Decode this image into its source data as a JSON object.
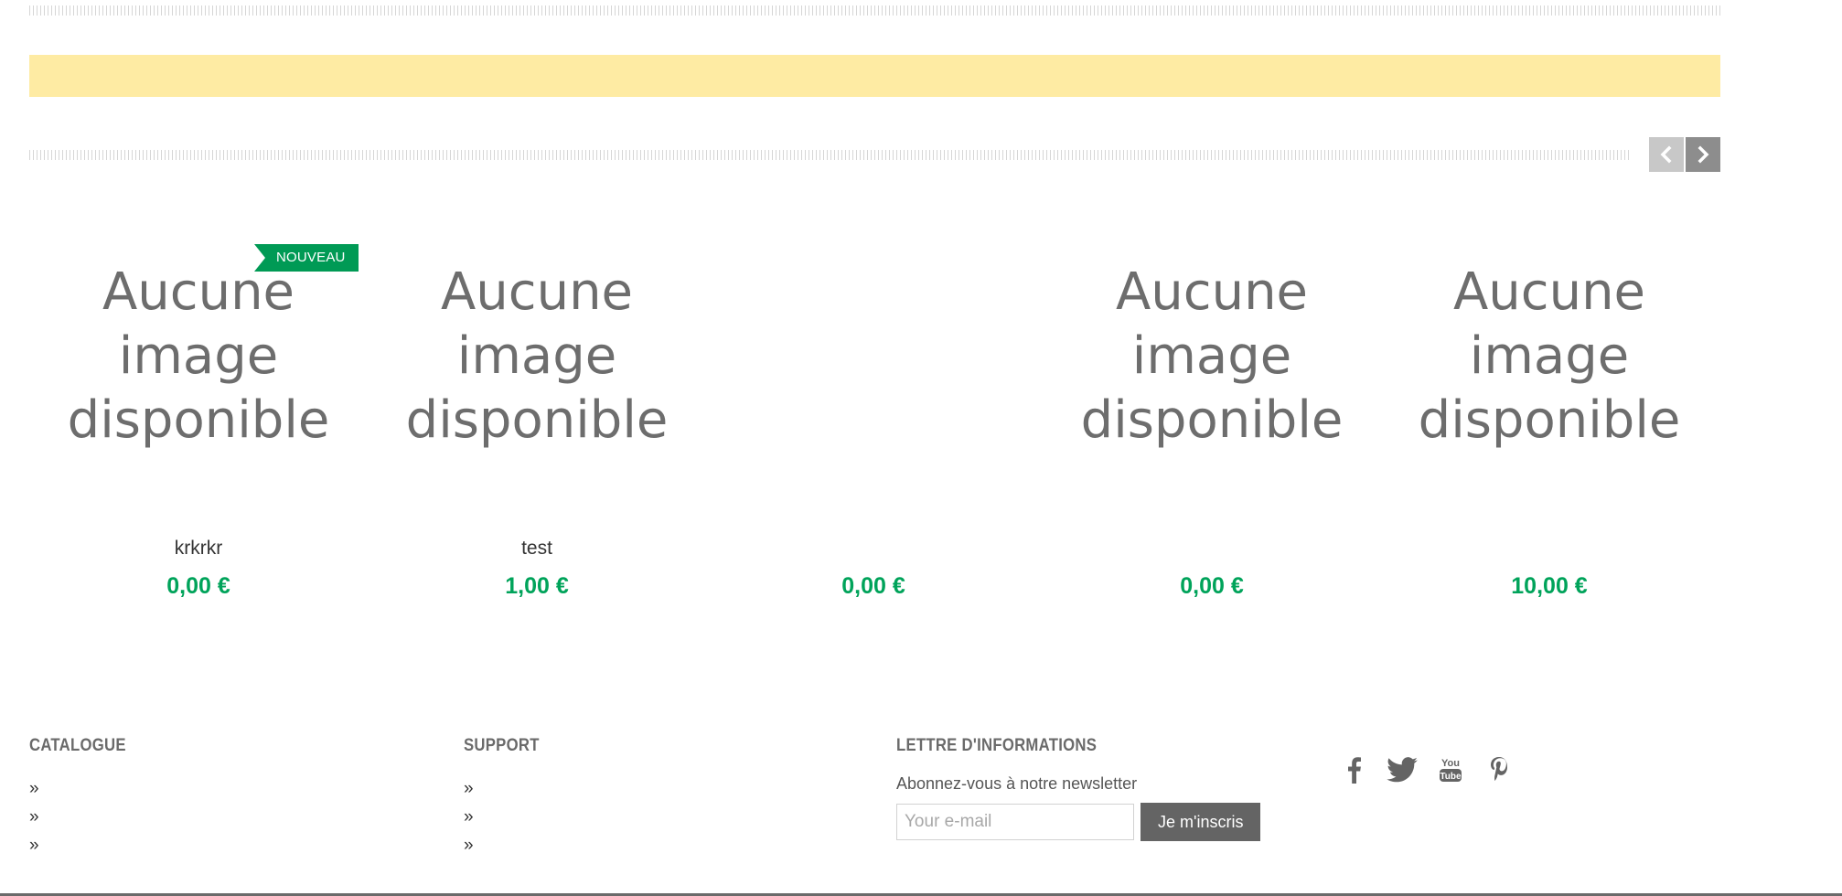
{
  "colors": {
    "accent_green": "#009a55",
    "price_green": "#00a35a",
    "banner_yellow": "#feeba3",
    "button_gray": "#646464"
  },
  "carousel": {
    "prev_icon": "chevron-left-icon",
    "next_icon": "chevron-right-icon"
  },
  "products": [
    {
      "name": "krkrkr",
      "price": "0,00 €",
      "badge": "NOUVEAU",
      "image_lines": [
        "Aucune",
        "image",
        "disponible"
      ]
    },
    {
      "name": "test",
      "price": "1,00 €",
      "badge": "",
      "image_lines": [
        "Aucune",
        "image",
        "disponible"
      ]
    },
    {
      "name": "",
      "price": "0,00 €",
      "badge": "",
      "image_lines": [
        "",
        "",
        ""
      ]
    },
    {
      "name": "",
      "price": "0,00 €",
      "badge": "",
      "image_lines": [
        "Aucune",
        "image",
        "disponible"
      ]
    },
    {
      "name": "",
      "price": "10,00 €",
      "badge": "",
      "image_lines": [
        "Aucune",
        "image",
        "disponible"
      ]
    }
  ],
  "footer": {
    "catalogue": {
      "title": "CATALOGUE",
      "items": [
        "»",
        "»",
        "»"
      ]
    },
    "support": {
      "title": "SUPPORT",
      "items": [
        "»",
        "»",
        "»"
      ]
    },
    "newsletter": {
      "title": "LETTRE D'INFORMATIONS",
      "text": "Abonnez-vous à notre newsletter",
      "placeholder": "Your e-mail",
      "button_label": "Je m'inscris"
    },
    "social": [
      "facebook-icon",
      "twitter-icon",
      "youtube-icon",
      "pinterest-icon"
    ]
  }
}
